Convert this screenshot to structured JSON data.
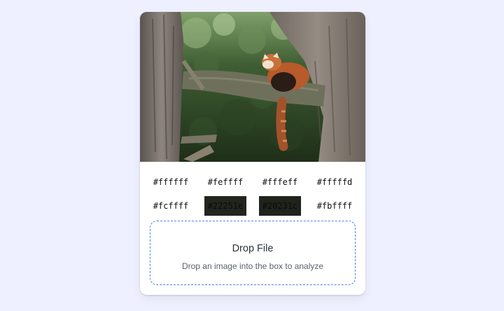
{
  "palette": {
    "swatches": [
      {
        "label": "#ffffff",
        "color": "#ffffff"
      },
      {
        "label": "#feffff",
        "color": "#feffff"
      },
      {
        "label": "#fffeff",
        "color": "#fffeff"
      },
      {
        "label": "#fffffd",
        "color": "#fffffd"
      },
      {
        "label": "#fcffff",
        "color": "#fcffff"
      },
      {
        "label": "#22251e",
        "color": "#22251e"
      },
      {
        "label": "#20231c",
        "color": "#20231c"
      },
      {
        "label": "#fbffff",
        "color": "#fbffff"
      }
    ]
  },
  "dropzone": {
    "title": "Drop File",
    "subtitle": "Drop an image into the box to analyze"
  },
  "colors": {
    "accent": "#4a86e8",
    "background": "#eef0ff"
  }
}
